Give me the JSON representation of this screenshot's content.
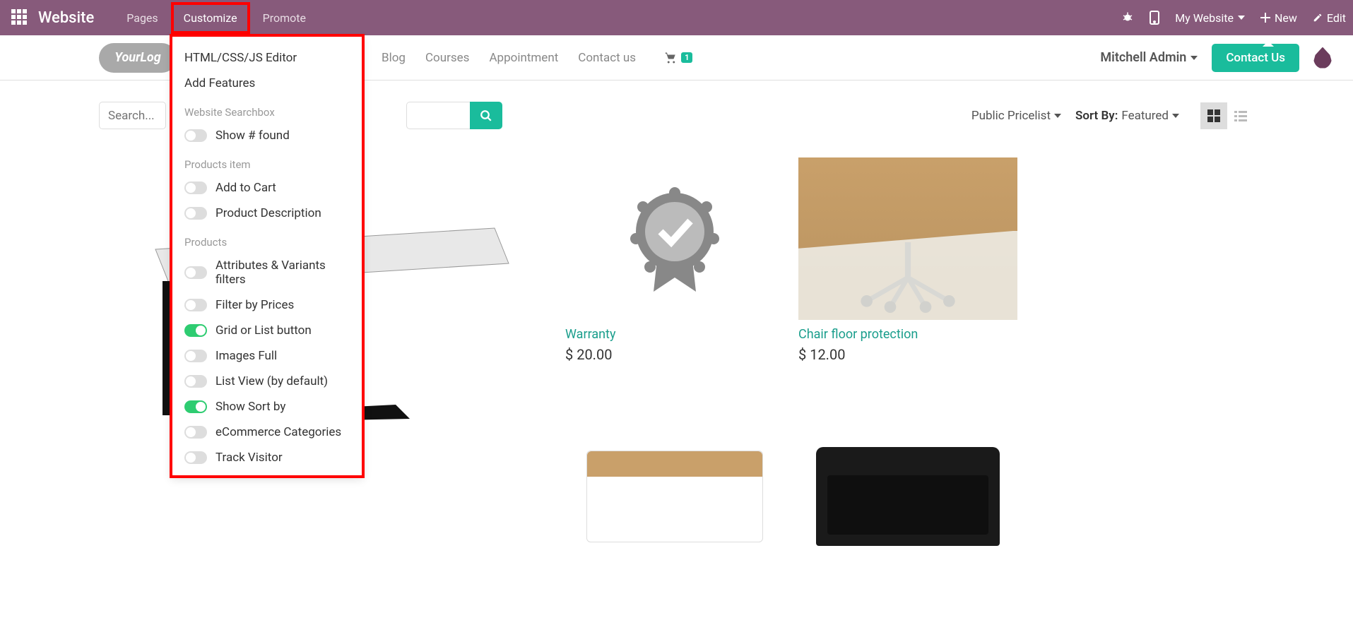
{
  "topbar": {
    "brand": "Website",
    "menu": [
      "Pages",
      "Customize",
      "Promote"
    ],
    "active_index": 1,
    "right": {
      "my_website": "My Website",
      "new": "New",
      "edit": "Edit"
    }
  },
  "header": {
    "logo_text": "YourLog",
    "nav": [
      "Blog",
      "Courses",
      "Appointment",
      "Contact us"
    ],
    "cart_count": "1",
    "user": "Mitchell Admin",
    "contact_btn": "Contact Us"
  },
  "toolbar": {
    "search_placeholder": "Search...",
    "pricelist": "Public Pricelist",
    "sort_label": "Sort By:",
    "sort_value": "Featured"
  },
  "dropdown": {
    "items_top": [
      "HTML/CSS/JS Editor",
      "Add Features"
    ],
    "sections": [
      {
        "title": "Website Searchbox",
        "toggles": [
          {
            "label": "Show # found",
            "on": false
          }
        ]
      },
      {
        "title": "Products item",
        "toggles": [
          {
            "label": "Add to Cart",
            "on": false
          },
          {
            "label": "Product Description",
            "on": false
          }
        ]
      },
      {
        "title": "Products",
        "toggles": [
          {
            "label": "Attributes & Variants filters",
            "on": false
          },
          {
            "label": "Filter by Prices",
            "on": false
          },
          {
            "label": "Grid or List button",
            "on": true
          },
          {
            "label": "Images Full",
            "on": false
          },
          {
            "label": "List View (by default)",
            "on": false
          },
          {
            "label": "Show Sort by",
            "on": true
          },
          {
            "label": "eCommerce Categories",
            "on": false
          },
          {
            "label": "Track Visitor",
            "on": false
          }
        ]
      }
    ]
  },
  "products": [
    {
      "title": "",
      "price": ""
    },
    {
      "title": "Warranty",
      "price": "$ 20.00"
    },
    {
      "title": "Chair floor protection",
      "price": "$ 12.00"
    },
    {
      "title": "",
      "price": ""
    },
    {
      "title": "",
      "price": ""
    },
    {
      "title": "",
      "price": ""
    }
  ]
}
